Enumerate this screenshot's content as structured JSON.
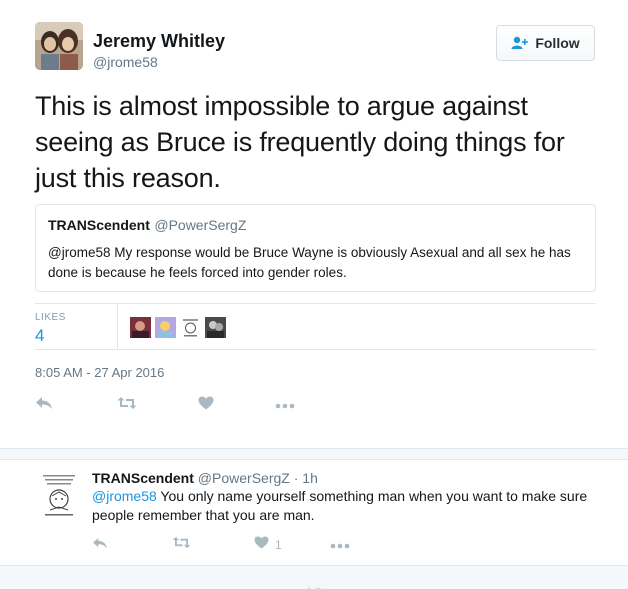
{
  "tweet": {
    "author_name": "Jeremy Whitley",
    "author_handle": "@jrome58",
    "follow_label": "Follow",
    "text": "This is almost impossible to argue against seeing as Bruce is frequently doing things for just this reason.",
    "quoted": {
      "author_name": "TRANScendent",
      "author_handle": "@PowerSergZ",
      "text": "@jrome58 My response would be Bruce Wayne is obviously Asexual and all sex he has done is because he feels forced into gender roles."
    },
    "likes_label": "LIKES",
    "likes_count": "4",
    "timestamp": "8:05 AM - 27 Apr 2016"
  },
  "reply": {
    "author_name": "TRANScendent",
    "author_handle": "@PowerSergZ",
    "separator": "·",
    "time": "1h",
    "mention": "@jrome58",
    "text": " You only name yourself something man when you want to make sure people remember that you are man.",
    "like_count": "1"
  },
  "colors": {
    "accent": "#1b95e0",
    "icon_gray": "#aab8c2",
    "secondary_text": "#657786"
  }
}
